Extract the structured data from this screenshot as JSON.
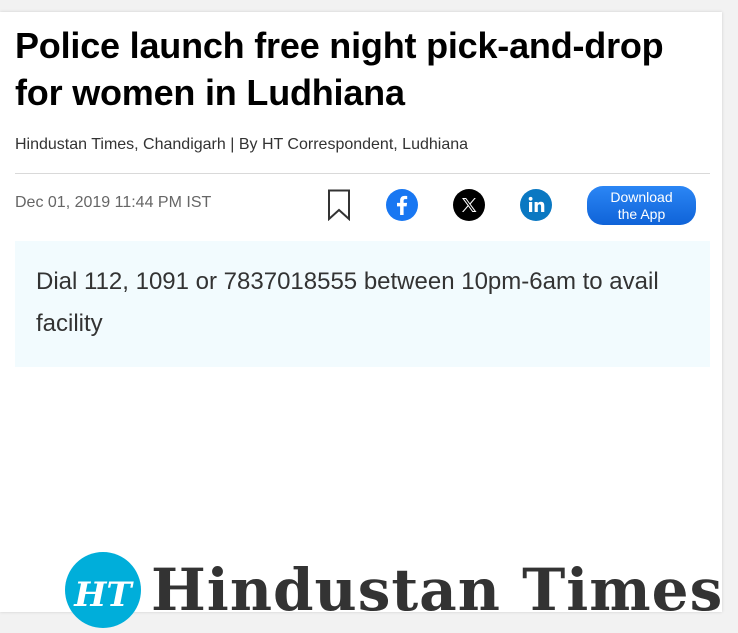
{
  "article": {
    "headline": "Police launch free night pick-and-drop for women in Ludhiana",
    "byline": "Hindustan Times, Chandigarh | By HT Correspondent, Ludhiana",
    "dateline": "Dec 01, 2019 11:44 PM IST",
    "summary": "Dial 112, 1091 or 7837018555 between 10pm-6am to avail facility"
  },
  "actions": {
    "bookmark_icon": "bookmark-icon",
    "share": [
      {
        "name": "facebook",
        "icon": "facebook-icon",
        "color": "#1877f2"
      },
      {
        "name": "x",
        "icon": "x-icon",
        "color": "#000000"
      },
      {
        "name": "linkedin",
        "icon": "linkedin-icon",
        "color": "#0a78c2"
      }
    ],
    "app_button": {
      "line1": "Download",
      "line2": "the App",
      "color": "#1a73e8"
    }
  },
  "logo": {
    "text": "Hindustan Times",
    "badge": "HT",
    "badge_color": "#00aeda"
  },
  "colors": {
    "summary_bg": "#f2fbfe",
    "headline": "#000000"
  }
}
